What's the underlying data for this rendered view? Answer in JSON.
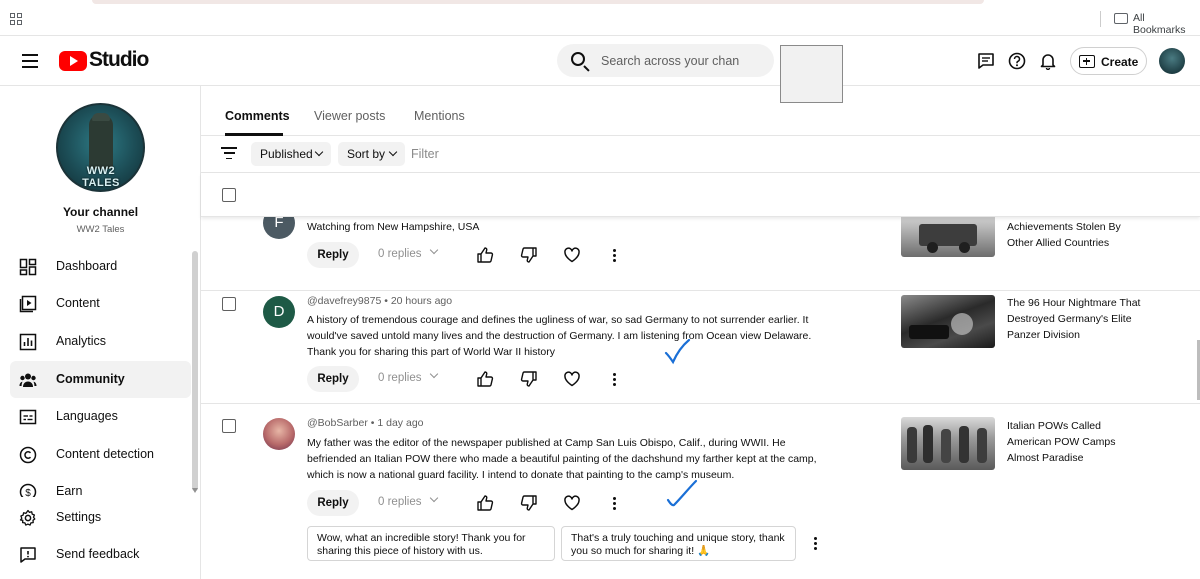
{
  "browser": {
    "bookmarks_label": "All Bookmarks"
  },
  "header": {
    "logo_text": "Studio",
    "search_placeholder": "Search across your chan",
    "create_label": "Create"
  },
  "sidebar": {
    "channel_avatar_text": "WW2 TALES",
    "your_channel": "Your channel",
    "channel_name": "WW2 Tales",
    "items": [
      {
        "label": "Dashboard",
        "icon": "dashboard-icon",
        "active": false
      },
      {
        "label": "Content",
        "icon": "content-icon",
        "active": false
      },
      {
        "label": "Analytics",
        "icon": "analytics-icon",
        "active": false
      },
      {
        "label": "Community",
        "icon": "community-icon",
        "active": true
      },
      {
        "label": "Languages",
        "icon": "languages-icon",
        "active": false
      },
      {
        "label": "Content detection",
        "icon": "copyright-icon",
        "active": false
      },
      {
        "label": "Earn",
        "icon": "earn-icon",
        "active": false
      }
    ],
    "settings": "Settings",
    "send_feedback": "Send feedback"
  },
  "tabs": [
    {
      "label": "Comments",
      "active": true
    },
    {
      "label": "Viewer posts",
      "active": false
    },
    {
      "label": "Mentions",
      "active": false
    }
  ],
  "filters": {
    "published": "Published",
    "sort_by": "Sort by",
    "filter_placeholder": "Filter"
  },
  "comments": [
    {
      "avatar_letter": "F",
      "avatar_color": "#4c5a63",
      "text": "Watching from New Hampshire,  USA",
      "reply_label": "Reply",
      "replies": "0 replies",
      "video_title": "Achievements Stolen By Other Allied Countries"
    },
    {
      "avatar_letter": "D",
      "avatar_color": "#1e5a46",
      "handle": "@davefrey9875",
      "time": "20 hours ago",
      "text": "A history of tremendous courage and defines the ugliness of war, so sad Germany to not surrender earlier. It would've saved untold many lives and the destruction of Germany. I am listening from Ocean view Delaware. Thank you for sharing this part of World War II history",
      "reply_label": "Reply",
      "replies": "0 replies",
      "video_title": "The 96 Hour Nightmare That Destroyed Germany's Elite Panzer Division"
    },
    {
      "avatar_letter": "",
      "avatar_color": "#b86a6a",
      "handle": "@BobSarber",
      "time": "1 day ago",
      "text": "My father was the editor of the newspaper published at Camp San Luis Obispo, Calif., during WWII. He befriended an Italian POW there who made a beautiful painting of the dachshund my farther kept at the camp, which is now a national guard facility. I intend to donate that painting to the camp's museum.",
      "reply_label": "Reply",
      "replies": "0 replies",
      "video_title": "Italian POWs Called American POW Camps Almost Paradise",
      "suggestions": [
        "Wow, what an incredible story! Thank you for sharing this piece of history with us.",
        "That's a truly touching and unique story, thank you so much for sharing it! 🙏"
      ]
    }
  ],
  "colors": {
    "brand_red": "#ff0000",
    "annotation_blue": "#1a6fd6"
  }
}
